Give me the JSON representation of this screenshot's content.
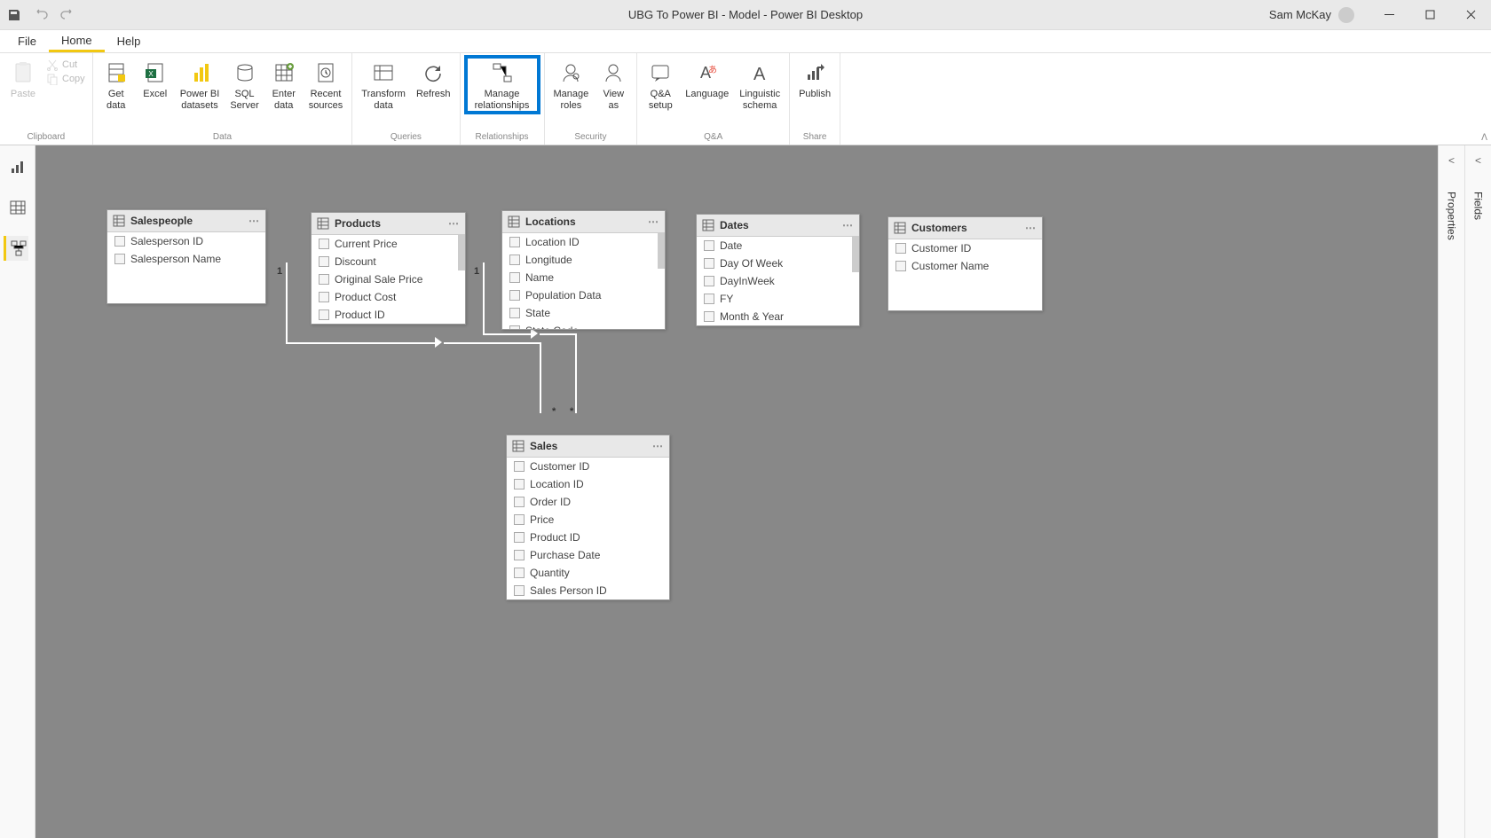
{
  "titlebar": {
    "title": "UBG To Power BI - Model - Power BI Desktop",
    "user": "Sam McKay"
  },
  "menu": {
    "file": "File",
    "home": "Home",
    "help": "Help"
  },
  "ribbon": {
    "paste": "Paste",
    "cut": "Cut",
    "copy": "Copy",
    "get_data": "Get\ndata",
    "excel": "Excel",
    "pbi_datasets": "Power BI\ndatasets",
    "sql_server": "SQL\nServer",
    "enter_data": "Enter\ndata",
    "recent_sources": "Recent\nsources",
    "transform_data": "Transform\ndata",
    "refresh": "Refresh",
    "manage_relationships": "Manage\nrelationships",
    "manage_roles": "Manage\nroles",
    "view_as": "View\nas",
    "qna_setup": "Q&A\nsetup",
    "language": "Language",
    "linguistic_schema": "Linguistic\nschema",
    "publish": "Publish",
    "grp_clipboard": "Clipboard",
    "grp_data": "Data",
    "grp_queries": "Queries",
    "grp_relationships": "Relationships",
    "grp_security": "Security",
    "grp_qna": "Q&A",
    "grp_share": "Share"
  },
  "right_rail": {
    "properties": "Properties",
    "fields": "Fields"
  },
  "tables": {
    "salespeople": {
      "name": "Salespeople",
      "fields": [
        "Salesperson ID",
        "Salesperson Name"
      ]
    },
    "products": {
      "name": "Products",
      "fields": [
        "Current Price",
        "Discount",
        "Original Sale Price",
        "Product Cost",
        "Product ID"
      ]
    },
    "locations": {
      "name": "Locations",
      "fields": [
        "Location ID",
        "Longitude",
        "Name",
        "Population Data",
        "State",
        "State Code"
      ]
    },
    "dates": {
      "name": "Dates",
      "fields": [
        "Date",
        "Day Of Week",
        "DayInWeek",
        "FY",
        "Month & Year"
      ]
    },
    "customers": {
      "name": "Customers",
      "fields": [
        "Customer ID",
        "Customer Name"
      ]
    },
    "sales": {
      "name": "Sales",
      "fields": [
        "Customer ID",
        "Location ID",
        "Order ID",
        "Price",
        "Product ID",
        "Purchase Date",
        "Quantity",
        "Sales Person ID"
      ]
    }
  },
  "cardinality": {
    "one": "1",
    "many": "*"
  }
}
